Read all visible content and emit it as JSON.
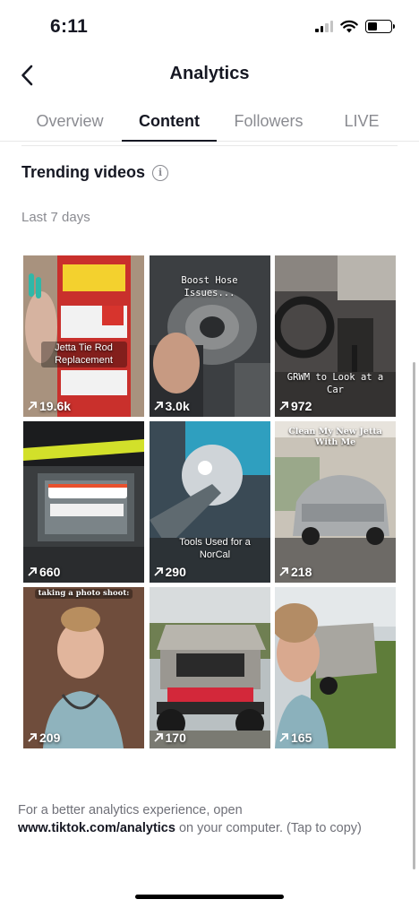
{
  "status_bar": {
    "time": "6:11",
    "battery_level": 0.4
  },
  "header": {
    "title": "Analytics",
    "back_icon": "chevron-left-icon"
  },
  "tabs": [
    {
      "label": "Overview",
      "active": false
    },
    {
      "label": "Content",
      "active": true
    },
    {
      "label": "Followers",
      "active": false
    },
    {
      "label": "LIVE",
      "active": false
    }
  ],
  "section": {
    "title": "Trending videos",
    "info_icon": "info-icon",
    "period": "Last 7 days"
  },
  "videos": [
    {
      "views": "19.6k",
      "caption": "Jetta Tie Rod Replacement"
    },
    {
      "views": "3.0k",
      "caption": "Boost Hose Issues..."
    },
    {
      "views": "972",
      "caption": "GRWM to Look at a Car"
    },
    {
      "views": "660",
      "caption": ""
    },
    {
      "views": "290",
      "caption": "Tools Used for a NorCal"
    },
    {
      "views": "218",
      "caption": "Clean My New Jetta With Me"
    },
    {
      "views": "209",
      "caption": "taking a photo shoot:"
    },
    {
      "views": "170",
      "caption": ""
    },
    {
      "views": "165",
      "caption": ""
    }
  ],
  "footer": {
    "text_before": "For a better analytics experience, open ",
    "link": "www.tiktok.com/analytics",
    "text_after": " on your computer. (Tap to copy)"
  },
  "colors": {
    "text_primary": "#161823",
    "text_secondary": "#8a8b91",
    "divider": "#e8e8e8"
  }
}
